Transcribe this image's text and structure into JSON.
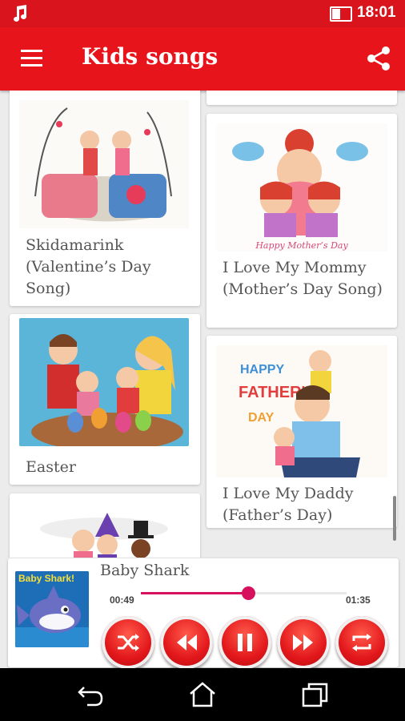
{
  "status_bar": {
    "time": "18:01",
    "music_icon": "music-note-icon",
    "battery_icon": "battery-icon"
  },
  "app_bar": {
    "title": "Kids songs",
    "menu_icon": "hamburger-menu-icon",
    "share_icon": "share-icon"
  },
  "songs": [
    {
      "title": "Skidamarink (Valentine’s Day Song)",
      "image": "valentine-couple-teacups"
    },
    {
      "title": "I Love My Mommy (Mother’s Day Song)",
      "image": "mother-hugging-children",
      "image_text": "Happy Mother’s Day"
    },
    {
      "title": "Easter",
      "image": "family-painting-easter-eggs"
    },
    {
      "title": "I Love My Daddy (Father’s Day)",
      "image": "father-with-children",
      "image_text": "HAPPY FATHER’S DAY"
    },
    {
      "title": "",
      "image": "kids-in-costumes"
    }
  ],
  "player": {
    "song_title": "Baby Shark",
    "art_text": "Baby Shark!",
    "current_time": "00:49",
    "total_time": "01:35",
    "progress": 0.52,
    "accent_color": "#d6105c",
    "controls": [
      "shuffle-icon",
      "rewind-icon",
      "pause-icon",
      "fast-forward-icon",
      "repeat-icon"
    ]
  },
  "nav_bar": {
    "back_icon": "back-icon",
    "home_icon": "home-icon",
    "recents_icon": "recents-icon"
  },
  "colors": {
    "app_bar": "#e8141c",
    "status_bar": "#d9141c",
    "control_button": "#e2171b"
  }
}
